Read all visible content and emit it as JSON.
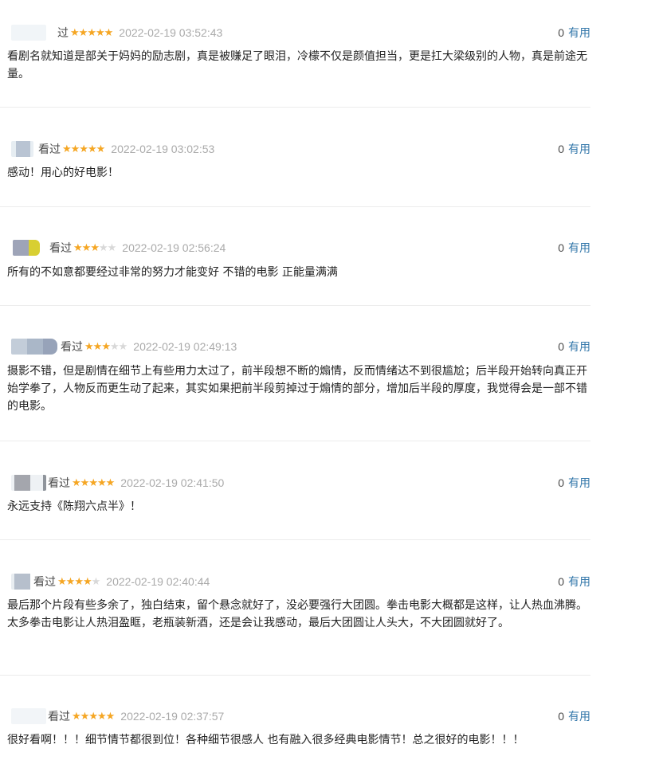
{
  "reviews": [
    {
      "verb": "过",
      "stars": 5,
      "time": "2022-02-19 03:52:43",
      "votes": "0",
      "vote_label": "有用",
      "text": "看剧名就知道是部关于妈妈的励志剧，真是被赚足了眼泪，冷檬不仅是颜值担当，更是扛大梁级别的人物，真是前途无量。"
    },
    {
      "verb": "看过",
      "stars": 5,
      "time": "2022-02-19 03:02:53",
      "votes": "0",
      "vote_label": "有用",
      "text": "感动！用心的好电影！"
    },
    {
      "verb": "看过",
      "stars": 3,
      "time": "2022-02-19 02:56:24",
      "votes": "0",
      "vote_label": "有用",
      "text": "所有的不如意都要经过非常的努力才能变好 不错的电影 正能量满满"
    },
    {
      "verb": "看过",
      "stars": 3,
      "time": "2022-02-19 02:49:13",
      "votes": "0",
      "vote_label": "有用",
      "text": "摄影不错，但是剧情在细节上有些用力太过了，前半段想不断的煽情，反而情绪达不到很尴尬；后半段开始转向真正开始学拳了，人物反而更生动了起来，其实如果把前半段剪掉过于煽情的部分，增加后半段的厚度，我觉得会是一部不错的电影。"
    },
    {
      "verb": "看过",
      "stars": 5,
      "time": "2022-02-19 02:41:50",
      "votes": "0",
      "vote_label": "有用",
      "text": "永远支持《陈翔六点半》！"
    },
    {
      "verb": "看过",
      "stars": 4,
      "time": "2022-02-19 02:40:44",
      "votes": "0",
      "vote_label": "有用",
      "text": "最后那个片段有些多余了，独白结束，留个悬念就好了，没必要强行大团圆。拳击电影大概都是这样，让人热血沸腾。太多拳击电影让人热泪盈眶，老瓶装新酒，还是会让我感动，最后大团圆让人头大，不大团圆就好了。"
    },
    {
      "verb": "看过",
      "stars": 5,
      "time": "2022-02-19 02:37:57",
      "votes": "0",
      "vote_label": "有用",
      "text": "很好看啊！！！细节情节都很到位！各种细节很感人 也有融入很多经典电影情节！总之很好的电影！！！"
    }
  ],
  "star_colors": {
    "on": "#f5a623",
    "off": "#d8d8d8"
  },
  "accent_color": "#3377aa"
}
